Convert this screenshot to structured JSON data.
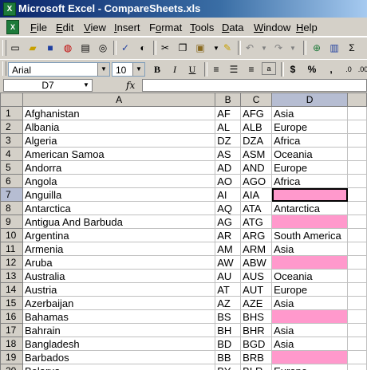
{
  "window": {
    "title": "Microsoft Excel - CompareSheets.xls"
  },
  "menu": [
    {
      "label": "File",
      "u": "F"
    },
    {
      "label": "Edit",
      "u": "E"
    },
    {
      "label": "View",
      "u": "V"
    },
    {
      "label": "Insert",
      "u": "I"
    },
    {
      "label": "Format",
      "u": "o"
    },
    {
      "label": "Tools",
      "u": "T"
    },
    {
      "label": "Data",
      "u": "D"
    },
    {
      "label": "Window",
      "u": "W"
    },
    {
      "label": "Help",
      "u": "H"
    }
  ],
  "formatting": {
    "font": "Arial",
    "size": "10"
  },
  "formula_bar": {
    "name_box": "D7",
    "fx": "fx",
    "value": ""
  },
  "columns": [
    "A",
    "B",
    "C",
    "D"
  ],
  "rows": [
    {
      "n": "1",
      "a": "Afghanistan",
      "b": "AF",
      "c": "AFG",
      "d": "Asia",
      "pink": false
    },
    {
      "n": "2",
      "a": "Albania",
      "b": "AL",
      "c": "ALB",
      "d": "Europe",
      "pink": false
    },
    {
      "n": "3",
      "a": "Algeria",
      "b": "DZ",
      "c": "DZA",
      "d": "Africa",
      "pink": false
    },
    {
      "n": "4",
      "a": "American Samoa",
      "b": "AS",
      "c": "ASM",
      "d": "Oceania",
      "pink": false
    },
    {
      "n": "5",
      "a": "Andorra",
      "b": "AD",
      "c": "AND",
      "d": "Europe",
      "pink": false
    },
    {
      "n": "6",
      "a": "Angola",
      "b": "AO",
      "c": "AGO",
      "d": "Africa",
      "pink": false
    },
    {
      "n": "7",
      "a": "Anguilla",
      "b": "AI",
      "c": "AIA",
      "d": "",
      "pink": true
    },
    {
      "n": "8",
      "a": "Antarctica",
      "b": "AQ",
      "c": "ATA",
      "d": "Antarctica",
      "pink": false
    },
    {
      "n": "9",
      "a": "Antigua And Barbuda",
      "b": "AG",
      "c": "ATG",
      "d": "",
      "pink": true
    },
    {
      "n": "10",
      "a": "Argentina",
      "b": "AR",
      "c": "ARG",
      "d": "South America",
      "pink": false
    },
    {
      "n": "11",
      "a": "Armenia",
      "b": "AM",
      "c": "ARM",
      "d": "Asia",
      "pink": false
    },
    {
      "n": "12",
      "a": "Aruba",
      "b": "AW",
      "c": "ABW",
      "d": "",
      "pink": true
    },
    {
      "n": "13",
      "a": "Australia",
      "b": "AU",
      "c": "AUS",
      "d": "Oceania",
      "pink": false
    },
    {
      "n": "14",
      "a": "Austria",
      "b": "AT",
      "c": "AUT",
      "d": "Europe",
      "pink": false
    },
    {
      "n": "15",
      "a": "Azerbaijan",
      "b": "AZ",
      "c": "AZE",
      "d": "Asia",
      "pink": false
    },
    {
      "n": "16",
      "a": "Bahamas",
      "b": "BS",
      "c": "BHS",
      "d": "",
      "pink": true
    },
    {
      "n": "17",
      "a": "Bahrain",
      "b": "BH",
      "c": "BHR",
      "d": "Asia",
      "pink": false
    },
    {
      "n": "18",
      "a": "Bangladesh",
      "b": "BD",
      "c": "BGD",
      "d": "Asia",
      "pink": false
    },
    {
      "n": "19",
      "a": "Barbados",
      "b": "BB",
      "c": "BRB",
      "d": "",
      "pink": true
    },
    {
      "n": "20",
      "a": "Belarus",
      "b": "BY",
      "c": "BLR",
      "d": "Europe",
      "pink": false
    }
  ],
  "active_cell": "D7",
  "colors": {
    "pink": "#ff99cc",
    "title_start": "#0a246a",
    "selected_header": "#b6bdd2"
  }
}
